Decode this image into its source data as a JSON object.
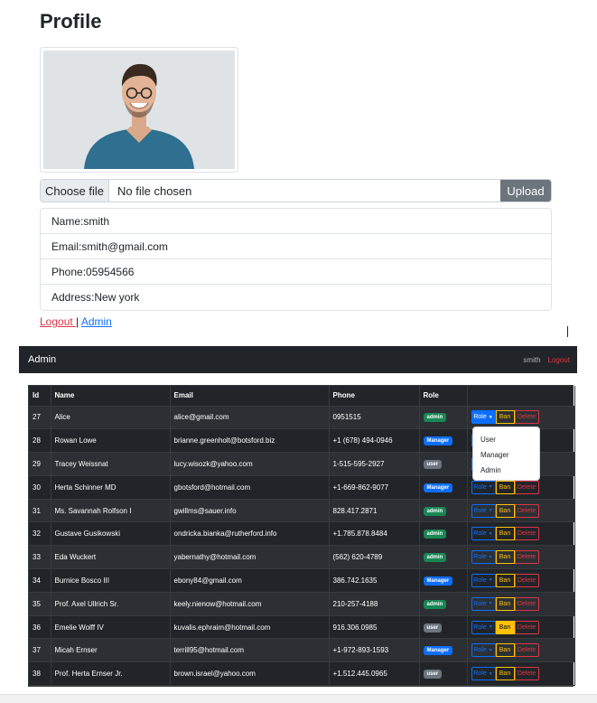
{
  "profile": {
    "title": "Profile",
    "file_input": {
      "button": "Choose file",
      "status": "No file chosen",
      "upload": "Upload"
    },
    "info": [
      {
        "key": "name",
        "text": "Name:smith"
      },
      {
        "key": "email",
        "text": "Email:smith@gmail.com"
      },
      {
        "key": "phone",
        "text": "Phone:05954566"
      },
      {
        "key": "address",
        "text": "Address:New york"
      }
    ],
    "links": {
      "logout": "Logout ",
      "separator": "|",
      "admin": "Admin"
    }
  },
  "navbar": {
    "brand": "Admin",
    "user": "smith",
    "logout": "Logout"
  },
  "table": {
    "headers": [
      "Id",
      "Name",
      "Email",
      "Phone",
      "Role",
      ""
    ],
    "action_labels": {
      "role": "Role",
      "ban": "Ban",
      "delete": "Delete"
    },
    "rows": [
      {
        "id": "27",
        "name": "Alice",
        "email": "alice@gmail.com",
        "phone": "0951515",
        "role": "admin"
      },
      {
        "id": "28",
        "name": "Rowan Lowe",
        "email": "brianne.greenholt@botsford.biz",
        "phone": "+1 (678) 494-0946",
        "role": "Manager"
      },
      {
        "id": "29",
        "name": "Tracey Weissnat",
        "email": "lucy.wisozk@yahoo.com",
        "phone": "1-515-595-2927",
        "role": "user"
      },
      {
        "id": "30",
        "name": "Herta Schinner MD",
        "email": "gbotsford@hotmail.com",
        "phone": "+1-669-862-9077",
        "role": "Manager"
      },
      {
        "id": "31",
        "name": "Ms. Savannah Rolfson I",
        "email": "gwillms@sauer.info",
        "phone": "828.417.2871",
        "role": "admin"
      },
      {
        "id": "32",
        "name": "Gustave Gusikowski",
        "email": "ondricka.bianka@rutherford.info",
        "phone": "+1.785.878.8484",
        "role": "admin"
      },
      {
        "id": "33",
        "name": "Eda Wuckert",
        "email": "yabernathy@hotmail.com",
        "phone": "(562) 620-4789",
        "role": "admin"
      },
      {
        "id": "34",
        "name": "Burnice Bosco III",
        "email": "ebony84@gmail.com",
        "phone": "386.742.1635",
        "role": "Manager"
      },
      {
        "id": "35",
        "name": "Prof. Axel Ullrich Sr.",
        "email": "keely.nienow@hotmail.com",
        "phone": "210-257-4188",
        "role": "admin"
      },
      {
        "id": "36",
        "name": "Emelie Wolff IV",
        "email": "kuvalis.ephraim@hotmail.com",
        "phone": "916.306.0985",
        "role": "user"
      },
      {
        "id": "37",
        "name": "Micah Ernser",
        "email": "terrill95@hotmail.com",
        "phone": "+1-972-893-1593",
        "role": "Manager"
      },
      {
        "id": "38",
        "name": "Prof. Herta Ernser Jr.",
        "email": "brown.israel@yahoo.com",
        "phone": "+1.512.445.0965",
        "role": "user"
      }
    ]
  },
  "dropdown": {
    "items": [
      "User",
      "Manager",
      "Admin"
    ]
  },
  "colors": {
    "navbar_bg": "#212529",
    "primary": "#0d6efd",
    "warning": "#ffc107",
    "danger": "#dc3545",
    "success": "#198754",
    "secondary": "#6c757d"
  }
}
